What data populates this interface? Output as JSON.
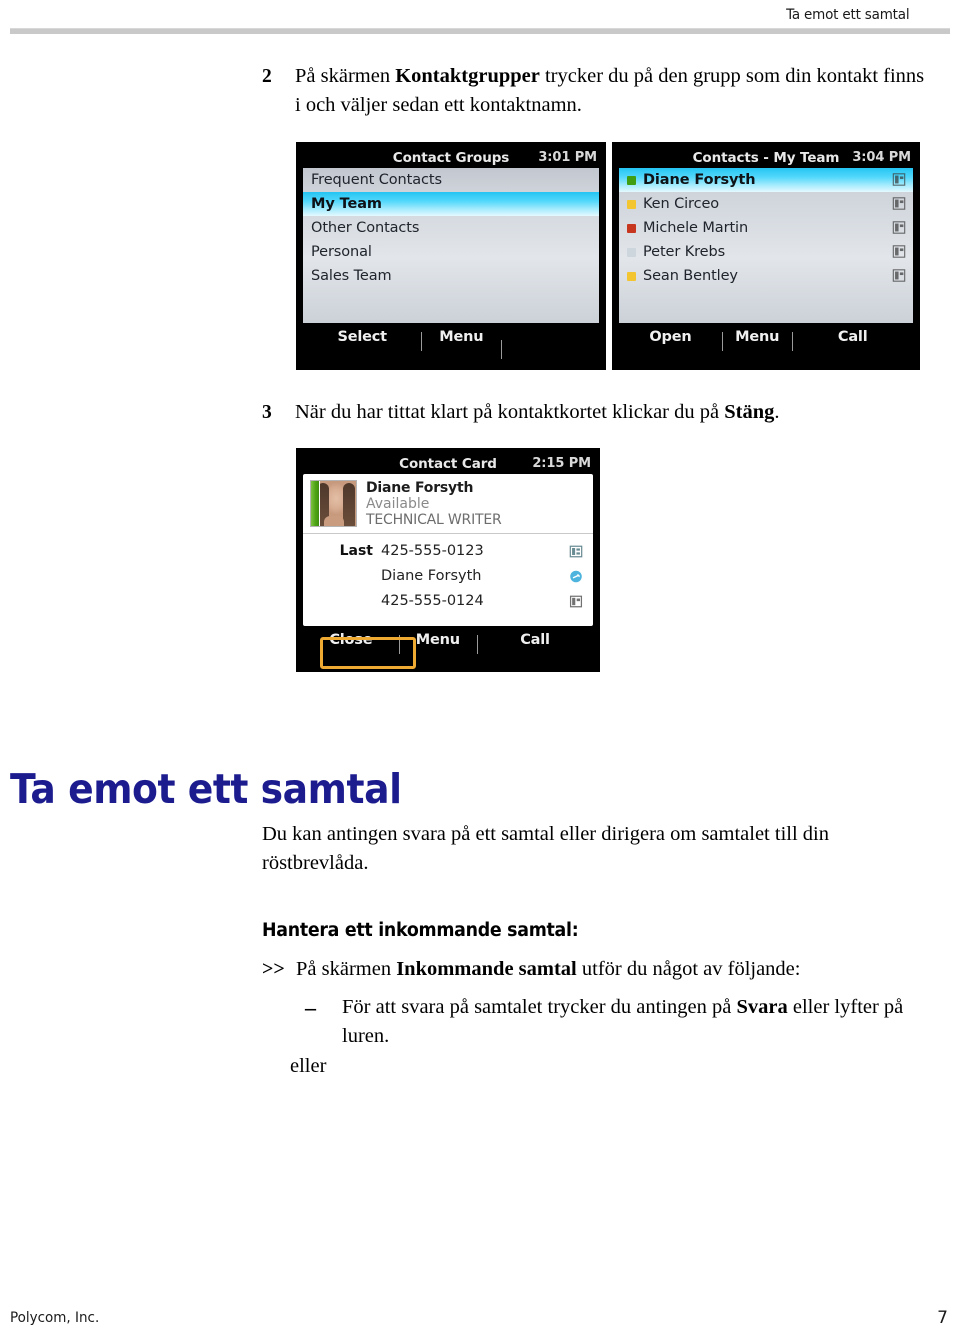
{
  "header": {
    "running_title": "Ta emot ett samtal"
  },
  "steps": {
    "step2": {
      "number": "2",
      "text_before": "På skärmen ",
      "bold": "Kontaktgrupper",
      "text_after": " trycker du på den grupp som din kontakt finns i och väljer sedan ett kontaktnamn."
    },
    "step3": {
      "number": "3",
      "text_before": "När du har tittat klart på kontaktkortet klickar du på ",
      "bold": "Stäng",
      "text_after": "."
    }
  },
  "screens": {
    "contact_groups": {
      "title": "Contact Groups",
      "clock": "3:01 PM",
      "rows": [
        {
          "label": "Frequent Contacts",
          "selected": false
        },
        {
          "label": "My Team",
          "selected": true
        },
        {
          "label": "Other Contacts",
          "selected": false
        },
        {
          "label": "Personal",
          "selected": false
        },
        {
          "label": "Sales Team",
          "selected": false
        }
      ],
      "softkeys": [
        "Select",
        "Menu",
        ""
      ]
    },
    "contacts_my_team": {
      "title": "Contacts - My Team",
      "clock": "3:04 PM",
      "rows": [
        {
          "label": "Diane Forsyth",
          "selected": true,
          "presence": "#3f9e12",
          "icon": "contact-card-icon"
        },
        {
          "label": "Ken Circeo",
          "selected": false,
          "presence": "#f2c531",
          "icon": "contact-card-icon"
        },
        {
          "label": "Michele Martin",
          "selected": false,
          "presence": "#c7361f",
          "icon": "contact-card-icon"
        },
        {
          "label": "Peter Krebs",
          "selected": false,
          "presence": "#cdd6dd",
          "icon": "contact-card-icon"
        },
        {
          "label": "Sean Bentley",
          "selected": false,
          "presence": "#f2c531",
          "icon": "contact-card-icon"
        }
      ],
      "softkeys": [
        "Open",
        "Menu",
        "Call"
      ]
    },
    "contact_card": {
      "title": "Contact Card",
      "clock": "2:15 PM",
      "contact_name": "Diane Forsyth",
      "presence_text": "Available",
      "job_title": "TECHNICAL WRITER",
      "presence_color": "#4fa416",
      "detail_rows": [
        {
          "label": "Last",
          "value": "425-555-0123",
          "icon": "work-phone-icon"
        },
        {
          "label": "",
          "value": "Diane Forsyth",
          "icon": "im-presence-icon"
        },
        {
          "label": "",
          "value": "425-555-0124",
          "icon": "mobile-phone-icon"
        }
      ],
      "softkeys": [
        "Close",
        "Menu",
        "Call"
      ],
      "highlight_color": "#eeaa33",
      "highlighted_softkey": "Close"
    }
  },
  "section": {
    "heading": "Ta emot ett samtal",
    "heading_color": "#1c1c8f",
    "intro": "Du kan antingen svara på ett samtal eller dirigera om samtalet till din röstbrevlåda.",
    "subheading": "Hantera ett inkommande samtal:",
    "bullet_gg": {
      "marker": ">>",
      "text_before": "På skärmen ",
      "bold": "Inkommande samtal",
      "text_after": " utför du något av följande:"
    },
    "bullet_dash": {
      "marker": "–",
      "text_before": "För att svara på samtalet trycker du antingen på ",
      "bold": "Svara",
      "text_after": " eller lyfter på luren."
    },
    "eller": "eller"
  },
  "footer": {
    "company": "Polycom, Inc.",
    "page_number": "7"
  }
}
